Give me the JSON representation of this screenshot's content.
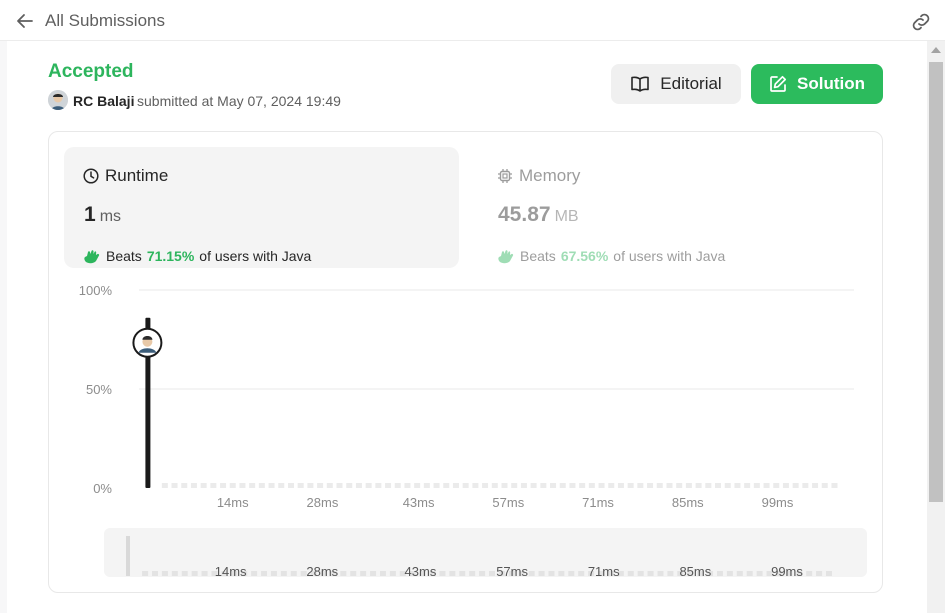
{
  "header": {
    "back_label": "All Submissions",
    "back_icon": "arrow-left-icon",
    "link_icon": "link-icon"
  },
  "submission": {
    "status": "Accepted",
    "status_color": "#2db55d",
    "submitter": "RC Balaji",
    "submitted_text": "submitted at May 07, 2024 19:49"
  },
  "actions": {
    "editorial_label": "Editorial",
    "solution_label": "Solution",
    "solution_color": "#2cbb5d"
  },
  "runtime": {
    "title": "Runtime",
    "value": "1",
    "unit": "ms",
    "beats_label": "Beats",
    "beats_pct": "71.15%",
    "beats_suffix": "of users with Java"
  },
  "memory": {
    "title": "Memory",
    "value": "45.87",
    "unit": "MB",
    "beats_label": "Beats",
    "beats_pct": "67.56%",
    "beats_suffix": "of users with Java"
  },
  "chart_data": {
    "type": "bar",
    "y_ticks": [
      "100%",
      "50%",
      "0%"
    ],
    "x_ticks": [
      "14ms",
      "28ms",
      "43ms",
      "57ms",
      "71ms",
      "85ms",
      "99ms"
    ],
    "ylim": [
      0,
      100
    ],
    "xlim": [
      0,
      110
    ],
    "highlight": {
      "x": 1,
      "value": 86
    },
    "bar_count": 70,
    "minimap_ticks": [
      "14ms",
      "28ms",
      "43ms",
      "57ms",
      "71ms",
      "85ms",
      "99ms"
    ]
  }
}
